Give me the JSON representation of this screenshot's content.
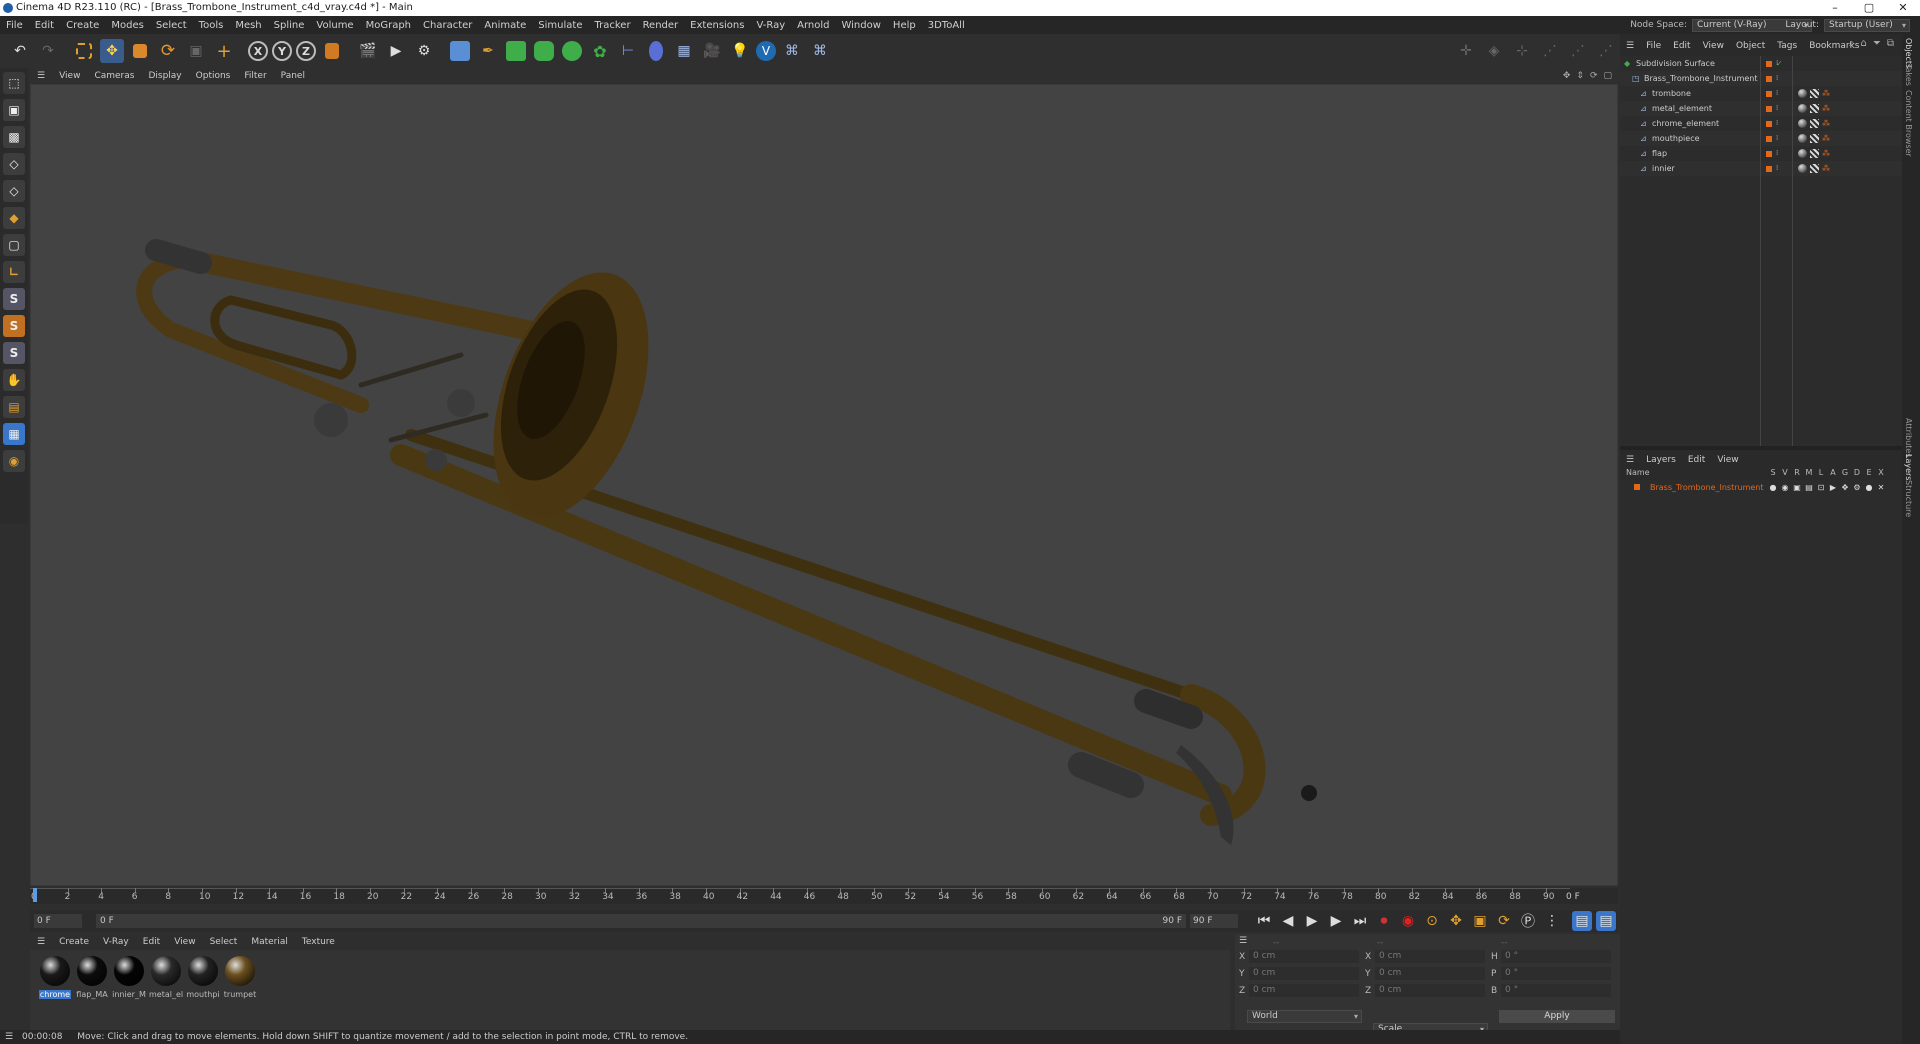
{
  "window": {
    "title": "Cinema 4D R23.110 (RC) - [Brass_Trombone_Instrument_c4d_vray.c4d *] - Main",
    "controls": [
      "–",
      "▢",
      "✕"
    ]
  },
  "menu": [
    "File",
    "Edit",
    "Create",
    "Modes",
    "Select",
    "Tools",
    "Mesh",
    "Spline",
    "Volume",
    "MoGraph",
    "Character",
    "Animate",
    "Simulate",
    "Tracker",
    "Render",
    "Extensions",
    "V-Ray",
    "Arnold",
    "Window",
    "Help",
    "3DToAll"
  ],
  "node_space": {
    "label": "Node Space:",
    "value": "Current (V-Ray)"
  },
  "layout": {
    "label": "Layout:",
    "value": "Startup (User)"
  },
  "toolbar_axes": [
    "X",
    "Y",
    "Z"
  ],
  "left_tools_letters": [
    "S",
    "S",
    "S"
  ],
  "viewport_menu": [
    "View",
    "Cameras",
    "Display",
    "Options",
    "Filter",
    "Panel"
  ],
  "timeline": {
    "ticks": [
      "0",
      "2",
      "4",
      "6",
      "8",
      "10",
      "12",
      "14",
      "16",
      "18",
      "20",
      "22",
      "24",
      "26",
      "28",
      "30",
      "32",
      "34",
      "36",
      "38",
      "40",
      "42",
      "44",
      "46",
      "48",
      "50",
      "52",
      "54",
      "56",
      "58",
      "60",
      "62",
      "64",
      "66",
      "68",
      "70",
      "72",
      "74",
      "76",
      "78",
      "80",
      "82",
      "84",
      "86",
      "88",
      "90"
    ],
    "current_frame_label": "0 F",
    "start_field": "0 F",
    "slider_start": "0 F",
    "slider_end": "90 F",
    "end_field": "90 F"
  },
  "material_menu": [
    "Create",
    "V-Ray",
    "Edit",
    "View",
    "Select",
    "Material",
    "Texture"
  ],
  "materials": [
    {
      "name": "chrome",
      "color": "#1a1a1a"
    },
    {
      "name": "flap_MA",
      "color": "#0c0c0c"
    },
    {
      "name": "innier_M",
      "color": "#050505"
    },
    {
      "name": "metal_el",
      "color": "#2a2a2a"
    },
    {
      "name": "mouthpi",
      "color": "#222222"
    },
    {
      "name": "trumpet",
      "color": "#6b4f1e"
    }
  ],
  "coords": {
    "header": [
      "--",
      "--",
      "--"
    ],
    "rows": [
      {
        "a": "X",
        "av": "0 cm",
        "b": "X",
        "bv": "0 cm",
        "c": "H",
        "cv": "0 °"
      },
      {
        "a": "Y",
        "av": "0 cm",
        "b": "Y",
        "bv": "0 cm",
        "c": "P",
        "cv": "0 °"
      },
      {
        "a": "Z",
        "av": "0 cm",
        "b": "Z",
        "bv": "0 cm",
        "c": "B",
        "cv": "0 °"
      }
    ],
    "space": "World",
    "mode": "Scale",
    "apply": "Apply"
  },
  "status": {
    "time": "00:00:08",
    "message": "Move: Click and drag to move elements. Hold down SHIFT to quantize movement / add to the selection in point mode, CTRL to remove."
  },
  "object_menu": [
    "File",
    "Edit",
    "View",
    "Object",
    "Tags",
    "Bookmarks"
  ],
  "objects": [
    {
      "name": "Subdivision Surface",
      "indent": 0
    },
    {
      "name": "Brass_Trombone_Instrument",
      "indent": 1
    },
    {
      "name": "trombone",
      "indent": 2
    },
    {
      "name": "metal_element",
      "indent": 2
    },
    {
      "name": "chrome_element",
      "indent": 2
    },
    {
      "name": "mouthpiece",
      "indent": 2
    },
    {
      "name": "flap",
      "indent": 2
    },
    {
      "name": "innier",
      "indent": 2
    }
  ],
  "layers_menu": [
    "Layers",
    "Edit",
    "View"
  ],
  "layers_header": {
    "name": "Name",
    "flags": [
      "S",
      "V",
      "R",
      "M",
      "L",
      "A",
      "G",
      "D",
      "E",
      "X"
    ]
  },
  "layers": [
    {
      "name": "Brass_Trombone_Instrument",
      "color": "#e0691c"
    }
  ],
  "side_tabs": [
    "Objects",
    "Takes",
    "Content Browser",
    "Attributes",
    "Layers",
    "Structure"
  ],
  "colors": {
    "accent": "#e0691c",
    "selection": "#3a76c9",
    "brass": "#6b4f1e"
  }
}
